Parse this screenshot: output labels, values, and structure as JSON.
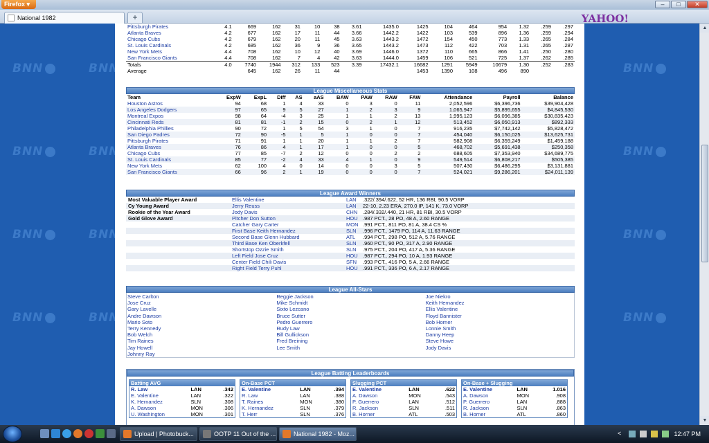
{
  "browser": {
    "menu_button": "Firefox",
    "tab_title": "National 1982",
    "new_tab": "+",
    "yahoo": "YAHOO!"
  },
  "top_rows": [
    [
      "Pittsburgh Pirates",
      "4.1",
      "669",
      "162",
      "31",
      "10",
      "38",
      "3.61",
      "1435.0",
      "1425",
      "104",
      "464",
      "954",
      "1.32",
      ".259",
      ".297"
    ],
    [
      "Atlanta Braves",
      "4.2",
      "677",
      "162",
      "17",
      "11",
      "44",
      "3.66",
      "1442.2",
      "1422",
      "103",
      "539",
      "896",
      "1.36",
      ".259",
      ".294"
    ],
    [
      "Chicago Cubs",
      "4.2",
      "679",
      "162",
      "20",
      "11",
      "45",
      "3.63",
      "1443.2",
      "1472",
      "154",
      "450",
      "773",
      "1.33",
      ".265",
      ".284"
    ],
    [
      "St. Louis Cardinals",
      "4.2",
      "685",
      "162",
      "36",
      "9",
      "36",
      "3.65",
      "1443.2",
      "1473",
      "112",
      "422",
      "703",
      "1.31",
      ".265",
      ".287"
    ],
    [
      "New York Mets",
      "4.4",
      "708",
      "162",
      "10",
      "12",
      "40",
      "3.69",
      "1446.0",
      "1372",
      "110",
      "665",
      "866",
      "1.41",
      ".250",
      ".280"
    ],
    [
      "San Francisco Giants",
      "4.4",
      "708",
      "162",
      "7",
      "4",
      "42",
      "3.63",
      "1444.0",
      "1459",
      "106",
      "521",
      "725",
      "1.37",
      ".262",
      ".285"
    ]
  ],
  "totals": [
    "Totals",
    "4.0",
    "7740",
    "1944",
    "312",
    "133",
    "523",
    "3.39",
    "17432.1",
    "16682",
    "1291",
    "5949",
    "10679",
    "1.30",
    ".252",
    ".283"
  ],
  "average": [
    "Average",
    "",
    "645",
    "162",
    "26",
    "11",
    "44",
    "",
    "",
    "1453",
    "1390",
    "108",
    "496",
    "890",
    "",
    ""
  ],
  "misc": {
    "title": "League Miscellaneous Stats",
    "headers": [
      "Team",
      "ExpW",
      "ExpL",
      "Diff",
      "AS",
      "aAS",
      "BAW",
      "PAW",
      "RAW",
      "FAW",
      "Attendance",
      "Payroll",
      "Balance"
    ],
    "rows": [
      [
        "Houston Astros",
        "94",
        "68",
        "1",
        "4",
        "33",
        "0",
        "3",
        "0",
        "11",
        "2,052,596",
        "$6,396,736",
        "$39,904,428"
      ],
      [
        "Los Angeles Dodgers",
        "97",
        "65",
        "9",
        "5",
        "27",
        "1",
        "2",
        "3",
        "9",
        "1,065,947",
        "$5,895,655",
        "$4,845,530"
      ],
      [
        "Montreal Expos",
        "98",
        "64",
        "-4",
        "3",
        "25",
        "1",
        "1",
        "2",
        "13",
        "1,995,123",
        "$6,096,385",
        "$30,835,423"
      ],
      [
        "Cincinnati Reds",
        "81",
        "81",
        "-1",
        "2",
        "15",
        "0",
        "2",
        "1",
        "12",
        "513,452",
        "$6,050,913",
        "$892,333"
      ],
      [
        "Philadelphia Phillies",
        "90",
        "72",
        "1",
        "5",
        "54",
        "3",
        "1",
        "0",
        "7",
        "916,235",
        "$7,742,142",
        "$5,828,472"
      ],
      [
        "San Diego Padres",
        "72",
        "90",
        "-5",
        "1",
        "5",
        "1",
        "0",
        "0",
        "7",
        "454,040",
        "$6,150,025",
        "$13,625,731"
      ],
      [
        "Pittsburgh Pirates",
        "71",
        "91",
        "1",
        "1",
        "20",
        "1",
        "1",
        "2",
        "7",
        "582,908",
        "$6,359,249",
        "$1,459,188"
      ],
      [
        "Atlanta Braves",
        "76",
        "86",
        "4",
        "1",
        "17",
        "1",
        "0",
        "0",
        "5",
        "468,702",
        "$5,691,438",
        "$250,358"
      ],
      [
        "Chicago Cubs",
        "77",
        "85",
        "-7",
        "2",
        "12",
        "0",
        "0",
        "2",
        "2",
        "688,605",
        "$7,353,940",
        "$34,689,775"
      ],
      [
        "St. Louis Cardinals",
        "85",
        "77",
        "-2",
        "4",
        "33",
        "4",
        "1",
        "0",
        "9",
        "549,514",
        "$6,808,217",
        "$505,385"
      ],
      [
        "New York Mets",
        "62",
        "100",
        "4",
        "0",
        "14",
        "0",
        "0",
        "3",
        "5",
        "507,430",
        "$6,486,295",
        "$3,131,881"
      ],
      [
        "San Francisco Giants",
        "66",
        "96",
        "2",
        "1",
        "19",
        "0",
        "0",
        "0",
        "7",
        "524,021",
        "$9,286,201",
        "$24,011,139"
      ]
    ]
  },
  "awards": {
    "title": "League Award Winners",
    "rows": [
      [
        "Most Valuable Player Award",
        "Ellis Valentine",
        "LAN",
        ".322/.394/.622, 52 HR, 136 RBI, 90.5 VORP"
      ],
      [
        "Cy Young Award",
        "Jerry Reuss",
        "LAN",
        "22-10, 2.23 ERA, 270.0 IP, 141 K, 73.0 VORP"
      ],
      [
        "Rookie of the Year Award",
        "Jody Davis",
        "CHN",
        ".284/.332/.440, 21 HR, 81 RBI, 30.5 VORP"
      ],
      [
        "Gold Glove Award",
        "Pitcher Don Sutton",
        "HOU",
        ".987 PCT., 28 PO, 48 A, 2.60 RANGE"
      ],
      [
        "",
        "Catcher Gary Carter",
        "MON",
        ".991 PCT., 811 PO, 81 A, 38.4 CS %"
      ],
      [
        "",
        "First Base Keith Hernandez",
        "SLN",
        ".996 PCT., 1479 PO, 114 A, 11.63 RANGE"
      ],
      [
        "",
        "Second Base Glenn Hubbard",
        "ATL",
        ".994 PCT., 298 PO, 512 A, 5.76 RANGE"
      ],
      [
        "",
        "Third Base Ken Oberkfell",
        "SLN",
        ".960 PCT., 90 PO, 317 A, 2.90 RANGE"
      ],
      [
        "",
        "Shortstop Ozzie Smith",
        "SLN",
        ".975 PCT., 204 PO, 417 A, 5.36 RANGE"
      ],
      [
        "",
        "Left Field Jose Cruz",
        "HOU",
        ".987 PCT., 294 PO, 10 A, 1.93 RANGE"
      ],
      [
        "",
        "Center Field Chili Davis",
        "SFN",
        ".993 PCT., 416 PO, 5 A, 2.66 RANGE"
      ],
      [
        "",
        "Right Field Terry Puhl",
        "HOU",
        ".991 PCT., 336 PO, 6 A, 2.17 RANGE"
      ]
    ]
  },
  "allstars": {
    "title": "League All-Stars",
    "col1": [
      "Steve Carlton",
      "Jose Cruz",
      "Gary Lavelle",
      "Andre Dawson",
      "Mario Soto",
      "Terry Kennedy",
      "Bob Welch",
      "Tim Raines",
      "Jay Howell",
      "Johnny Ray"
    ],
    "col2": [
      "Reggie Jackson",
      "Mike Schmidt",
      "Sixto Lezcano",
      "Bruce Sutter",
      "Pedro Guerrero",
      "Rudy Law",
      "Bill Gullickson",
      "Fred Breining",
      "Lee Smith"
    ],
    "col3": [
      "Joe Niekro",
      "Keith Hernandez",
      "Ellis Valentine",
      "Floyd Bannister",
      "Bob Horner",
      "Lonnie Smith",
      "Danny Heep",
      "Steve Howe",
      "Jody Davis"
    ]
  },
  "leaders": {
    "title": "League Batting Leaderboards",
    "boards": [
      {
        "title": "Batting AVG",
        "rows": [
          [
            "R. Law",
            "LAN",
            ".342"
          ],
          [
            "E. Valentine",
            "LAN",
            ".322"
          ],
          [
            "K. Hernandez",
            "SLN",
            ".308"
          ],
          [
            "A. Dawson",
            "MON",
            ".306"
          ],
          [
            "U. Washington",
            "MON",
            ".301"
          ]
        ]
      },
      {
        "title": "On-Base PCT",
        "rows": [
          [
            "E. Valentine",
            "LAN",
            ".394"
          ],
          [
            "R. Law",
            "LAN",
            ".388"
          ],
          [
            "T. Raines",
            "MON",
            ".380"
          ],
          [
            "K. Hernandez",
            "SLN",
            ".379"
          ],
          [
            "T. Herr",
            "SLN",
            ".376"
          ]
        ]
      },
      {
        "title": "Slugging PCT",
        "rows": [
          [
            "E. Valentine",
            "LAN",
            ".622"
          ],
          [
            "A. Dawson",
            "MON",
            ".543"
          ],
          [
            "P. Guerrero",
            "LAN",
            ".512"
          ],
          [
            "R. Jackson",
            "SLN",
            ".511"
          ],
          [
            "B. Horner",
            "ATL",
            ".503"
          ]
        ]
      },
      {
        "title": "On-Base + Slugging",
        "rows": [
          [
            "E. Valentine",
            "LAN",
            "1.016"
          ],
          [
            "A. Dawson",
            "MON",
            ".908"
          ],
          [
            "P. Guerrero",
            "LAN",
            ".888"
          ],
          [
            "R. Jackson",
            "SLN",
            ".863"
          ],
          [
            "B. Horner",
            "ATL",
            ".860"
          ]
        ]
      }
    ]
  },
  "taskbar": {
    "buttons": [
      "Upload | Photobuck...",
      "OOTP 11 Out of the ...",
      "National 1982 - Moz..."
    ],
    "clock": "12:47 PM",
    "arrow": "<"
  },
  "watermark": "BNN",
  "colors": {
    "page_bg": "#1f5db0",
    "header": "#4d7fc0",
    "link": "#1d3da3"
  }
}
